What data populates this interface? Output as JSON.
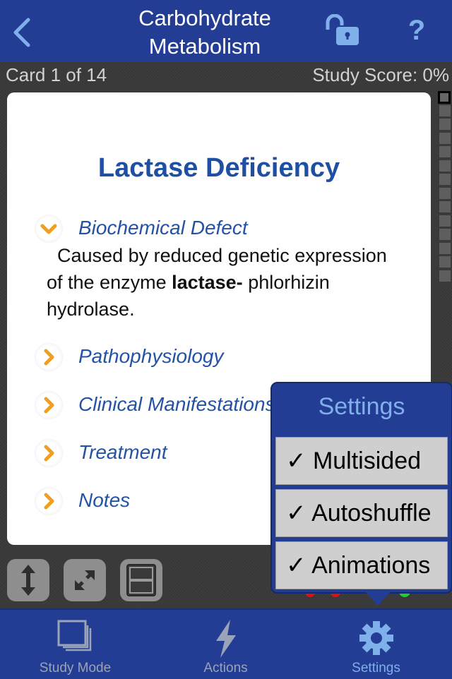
{
  "navbar": {
    "back_icon": "chevron-left-icon",
    "title_line1": "Carbohydrate",
    "title_line2": "Metabolism",
    "lock_icon": "unlocked-padlock-icon",
    "help_label": "?"
  },
  "status": {
    "card_count": "Card 1 of 14",
    "study_score": "Study Score: 0%"
  },
  "card": {
    "title": "Lactase Deficiency",
    "sections": [
      {
        "label": "Biochemical Defect",
        "expanded": true,
        "icon": "chevron-down-icon"
      },
      {
        "label": "Pathophysiology",
        "expanded": false,
        "icon": "chevron-right-icon"
      },
      {
        "label": "Clinical Manifestations",
        "expanded": false,
        "icon": "chevron-right-icon"
      },
      {
        "label": "Treatment",
        "expanded": false,
        "icon": "chevron-right-icon"
      },
      {
        "label": "Notes",
        "expanded": false,
        "icon": "chevron-right-icon"
      }
    ],
    "body": {
      "part1": "Caused by reduced genetic expression of the enzyme ",
      "bold": "lactase-",
      "part2": "phlorhizin hydrolase."
    }
  },
  "card_strip": {
    "total": 14,
    "current": 1
  },
  "tools": [
    {
      "name": "resize-vertical",
      "icon": "vertical-arrows-icon"
    },
    {
      "name": "fullscreen",
      "icon": "expand-arrows-icon"
    },
    {
      "name": "split-view",
      "icon": "split-panel-icon"
    }
  ],
  "popover": {
    "title": "Settings",
    "items": [
      {
        "label": "Multisided",
        "checked": true
      },
      {
        "label": "Autoshuffle",
        "checked": true
      },
      {
        "label": "Animations",
        "checked": true
      }
    ],
    "check_glyph": "✓"
  },
  "tabbar": {
    "tabs": [
      {
        "label": "Study Mode",
        "icon": "stacked-cards-icon",
        "active": false
      },
      {
        "label": "Actions",
        "icon": "lightning-bolt-icon",
        "active": false
      },
      {
        "label": "Settings",
        "icon": "gear-icon",
        "active": true
      }
    ]
  },
  "colors": {
    "bar_blue": "#233d94",
    "accent_light_blue": "#7fb0ea",
    "heading_blue": "#1f4fa3",
    "chevron_orange": "#f0a020",
    "tab_inactive": "#9aa3b8"
  }
}
